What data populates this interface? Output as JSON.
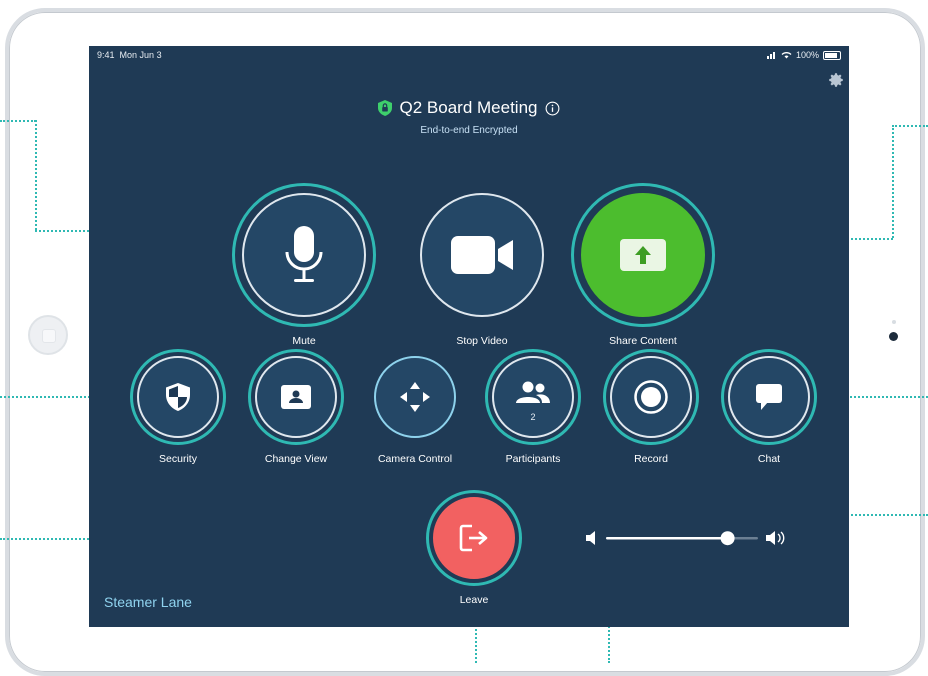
{
  "status_bar": {
    "time": "9:41",
    "date": "Mon Jun 3",
    "battery": "100%"
  },
  "meeting": {
    "title": "Q2 Board Meeting",
    "subtitle": "End-to-end Encrypted"
  },
  "buttons": {
    "mute": "Mute",
    "stop_video": "Stop Video",
    "share_content": "Share Content",
    "security": "Security",
    "change_view": "Change View",
    "camera_control": "Camera Control",
    "participants": "Participants",
    "participant_count": "2",
    "record": "Record",
    "chat": "Chat",
    "leave": "Leave"
  },
  "room_name": "Steamer Lane",
  "volume": {
    "level": 0.8
  },
  "icons": {
    "mute": "microphone-icon",
    "stop_video": "video-camera-icon",
    "share_content": "upload-arrow-icon",
    "security": "shield-icon",
    "change_view": "person-frame-icon",
    "camera_control": "four-arrows-icon",
    "participants": "people-icon",
    "record": "record-icon",
    "chat": "chat-bubble-icon",
    "leave": "exit-icon",
    "settings": "gear-icon",
    "encryption": "shield-lock-icon",
    "info": "info-icon"
  },
  "colors": {
    "screen_bg": "#1f3a55",
    "accent_ring": "#2fb9b3",
    "share_green": "#4cbd2e",
    "leave_red": "#f26161",
    "encrypted_green": "#3ecf6c"
  }
}
